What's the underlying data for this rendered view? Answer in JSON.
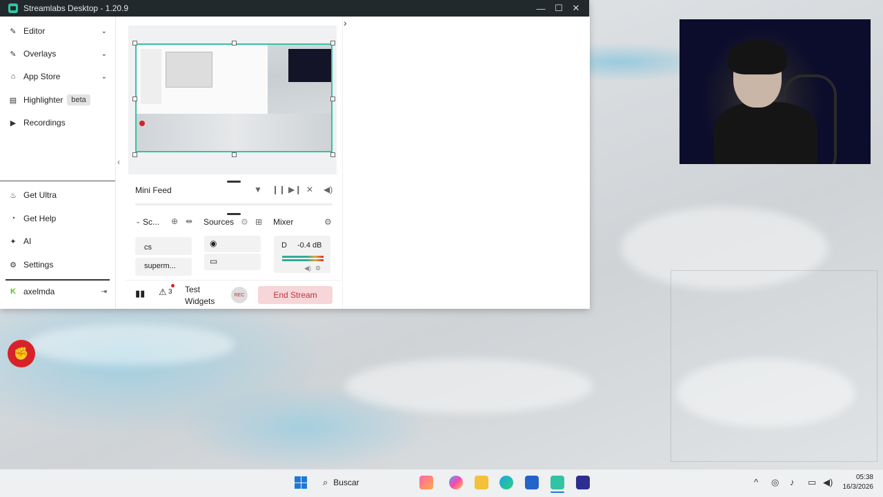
{
  "window": {
    "title": "Streamlabs Desktop - 1.20.9",
    "controls": {
      "minimize": "—",
      "maximize": "☐",
      "close": "✕"
    }
  },
  "sidebar": {
    "items": [
      {
        "label": "Editor",
        "icon": "editor-icon",
        "glyph": "✎",
        "chevron": "⌄"
      },
      {
        "label": "Overlays",
        "icon": "overlays-icon",
        "glyph": "✎",
        "chevron": "⌄"
      },
      {
        "label": "App Store",
        "icon": "store-icon",
        "glyph": "⌂",
        "chevron": "⌄"
      },
      {
        "label": "Highlighter",
        "icon": "highlighter-icon",
        "glyph": "▤",
        "badge": "beta"
      },
      {
        "label": "Recordings",
        "icon": "play-icon",
        "glyph": "▶"
      }
    ],
    "bottom_items": [
      {
        "label": "Get Ultra",
        "icon": "ultra-icon",
        "glyph": "♨"
      },
      {
        "label": "Get Help",
        "icon": "help-icon",
        "glyph": "◔"
      },
      {
        "label": "AI",
        "icon": "ai-icon",
        "glyph": "✦"
      },
      {
        "label": "Settings",
        "icon": "gear-icon",
        "glyph": "⚙"
      }
    ],
    "user": {
      "name": "axelmda",
      "logout_glyph": "⇥"
    },
    "collapse_glyph": "‹"
  },
  "mini_feed": {
    "title": "Mini Feed"
  },
  "scenes": {
    "title": "Sc...",
    "items": [
      "cs",
      "superm..."
    ]
  },
  "sources": {
    "title": "Sources"
  },
  "mixer": {
    "title": "Mixer",
    "channel": "D",
    "level": "-0.4 dB"
  },
  "footer": {
    "alerts_count": "3",
    "test_widgets": "Test Widgets",
    "rec_label": "REC",
    "end_stream": "End Stream"
  },
  "right_pane": {
    "toggle_glyph": "›"
  },
  "desktop_icon": {
    "label": "Riot Client"
  },
  "taskbar": {
    "search": "Buscar",
    "time": "05:38",
    "date": "16/3/2026"
  },
  "colors": {
    "accent": "#31c3a2",
    "end_stream_bg": "#f6d6d8",
    "end_stream_text": "#c0333a"
  }
}
